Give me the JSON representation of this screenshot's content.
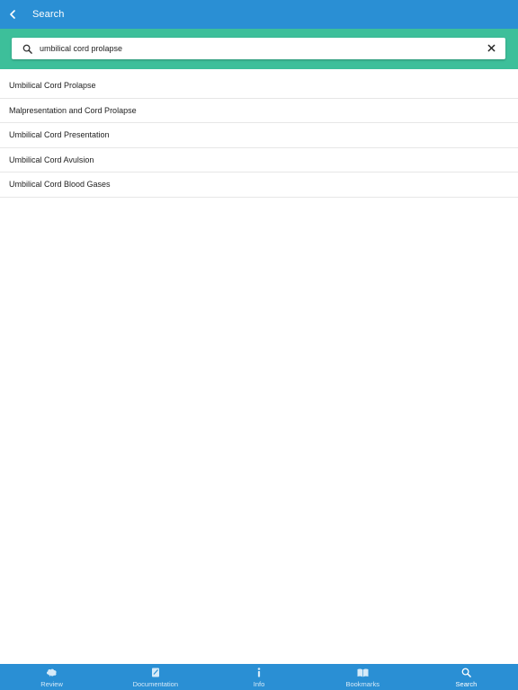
{
  "header": {
    "title": "Search",
    "back_icon": "chevron-left-icon"
  },
  "search": {
    "value": "umbilical cord prolapse",
    "placeholder": "",
    "search_icon": "search-icon",
    "clear_icon": "close-icon"
  },
  "results": [
    {
      "label": "Umbilical Cord Prolapse"
    },
    {
      "label": "Malpresentation and Cord Prolapse"
    },
    {
      "label": "Umbilical Cord Presentation"
    },
    {
      "label": "Umbilical Cord Avulsion"
    },
    {
      "label": "Umbilical Cord Blood Gases"
    }
  ],
  "tabbar": {
    "tabs": [
      {
        "label": "Review",
        "icon": "brain-icon",
        "active": false
      },
      {
        "label": "Documentation",
        "icon": "document-icon",
        "active": false
      },
      {
        "label": "Info",
        "icon": "info-icon",
        "active": false
      },
      {
        "label": "Bookmarks",
        "icon": "book-icon",
        "active": false
      },
      {
        "label": "Search",
        "icon": "search-icon",
        "active": true
      }
    ]
  },
  "colors": {
    "header": "#2a8fd4",
    "search_band": "#3dbf9a",
    "tabbar": "#2a8fd4"
  }
}
